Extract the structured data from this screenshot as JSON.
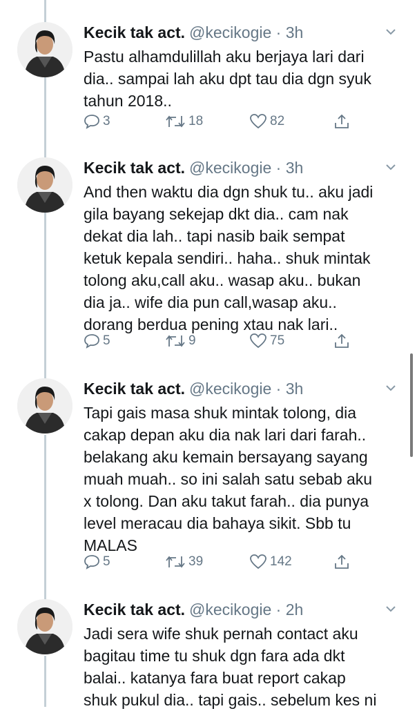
{
  "tweets": [
    {
      "name": "Kecik tak act.",
      "handle": "@kecikogie",
      "time": "· 3h",
      "text": "Pastu alhamdulillah aku berjaya lari dari\ndia.. sampai lah aku dpt tau dia dgn syuk\ntahun 2018..",
      "replies": "3",
      "retweets": "18",
      "likes": "82"
    },
    {
      "name": "Kecik tak act.",
      "handle": "@kecikogie",
      "time": "· 3h",
      "text": "And then waktu dia dgn shuk tu.. aku jadi\ngila bayang sekejap dkt dia.. cam nak\ndekat dia lah.. tapi nasib baik sempat\nketuk kepala sendiri.. haha.. shuk mintak\ntolong aku,call aku.. wasap aku.. bukan\ndia ja.. wife dia pun call,wasap aku..\ndorang berdua pening xtau nak lari..",
      "replies": "5",
      "retweets": "9",
      "likes": "75"
    },
    {
      "name": "Kecik tak act.",
      "handle": "@kecikogie",
      "time": "· 3h",
      "text": "Tapi gais masa shuk mintak tolong, dia\ncakap depan aku dia nak lari dari farah..\nbelakang aku kemain bersayang sayang\nmuah muah.. so ini salah satu sebab aku\nx tolong. Dan aku takut farah.. dia punya\nlevel meracau dia bahaya sikit. Sbb tu\nMALAS",
      "replies": "5",
      "retweets": "39",
      "likes": "142"
    },
    {
      "name": "Kecik tak act.",
      "handle": "@kecikogie",
      "time": "· 2h",
      "text": "Jadi sera wife shuk pernah contact aku\nbagitau time tu shuk dgn fara ada dkt\nbalai.. katanya fara buat report cakap\nshuk pukul dia.. tapi gais.. sebelum kes ni",
      "replies": "",
      "retweets": "",
      "likes": ""
    }
  ],
  "icons": {
    "reply": "reply-icon",
    "retweet": "retweet-icon",
    "like": "heart-icon",
    "share": "share-icon",
    "caret": "chevron-down-icon",
    "avatar": "avatar"
  },
  "colors": {
    "thread_line": "#c4cfd6",
    "muted": "#657786",
    "text": "#14171a"
  }
}
